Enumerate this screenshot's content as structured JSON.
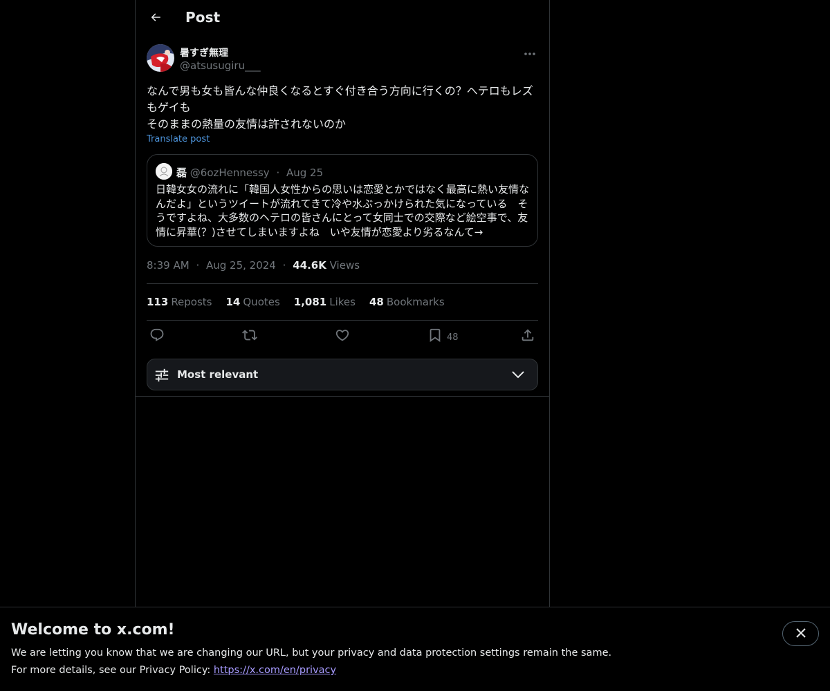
{
  "header": {
    "title": "Post"
  },
  "post": {
    "author": {
      "display_name": "暑すぎ無理",
      "handle": "@atsusugiru___"
    },
    "text": "なんで男も女も皆んな仲良くなるとすぐ付き合う方向に行くの？ヘテロもレズもゲイも\nそのままの熱量の友情は許されないのか",
    "translate_label": "Translate post",
    "quote": {
      "display_name": "磊",
      "handle": "@6ozHennessy",
      "separator": "·",
      "date": "Aug 25",
      "text": "日韓女女の流れに「韓国人女性からの思いは恋愛とかではなく最高に熱い友情なんだよ」というツイートが流れてきて冷や水ぶっかけられた気になっている　そうですよね、大多数のヘテロの皆さんにとって女同士での交際など絵空事で、友情に昇華(？)させてしまいますよね　いや友情が恋愛より劣るなんて→"
    },
    "time": "8:39 AM",
    "separator": "·",
    "date": "Aug 25, 2024",
    "views_count": "44.6K",
    "views_label": "Views"
  },
  "stats": {
    "reposts": {
      "count": "113",
      "label": "Reposts"
    },
    "quotes": {
      "count": "14",
      "label": "Quotes"
    },
    "likes": {
      "count": "1,081",
      "label": "Likes"
    },
    "bookmarks": {
      "count": "48",
      "label": "Bookmarks"
    }
  },
  "actions": {
    "bookmark_count": "48"
  },
  "sort": {
    "label": "Most relevant"
  },
  "banner": {
    "title": "Welcome to x.com!",
    "line1": "We are letting you know that we are changing our URL, but your privacy and data protection settings remain the same.",
    "line2_prefix": "For more details, see our Privacy Policy: ",
    "link": "https://x.com/en/privacy"
  },
  "colors": {
    "background": "#000000",
    "text_primary": "#e7e9ea",
    "text_secondary": "#71767b",
    "link": "#4d93d9",
    "border": "#2f3336"
  }
}
